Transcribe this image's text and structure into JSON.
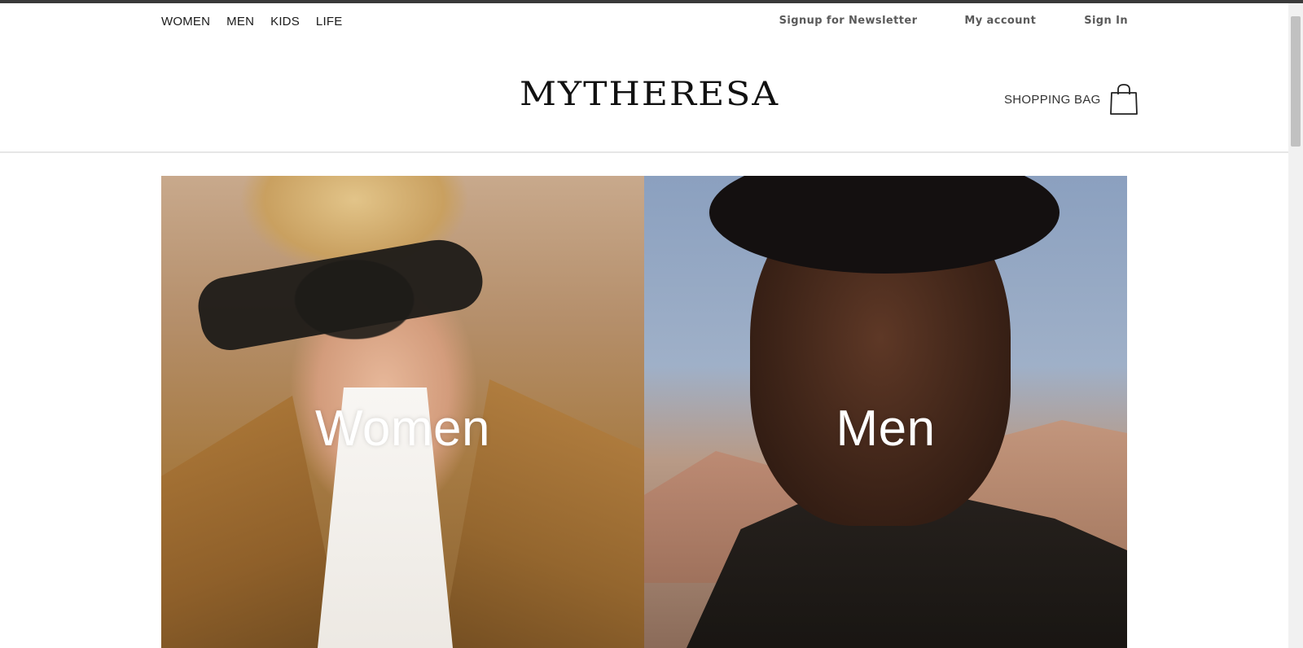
{
  "top_nav": {
    "departments": [
      "WOMEN",
      "MEN",
      "KIDS",
      "LIFE"
    ],
    "newsletter_label": "Signup for Newsletter",
    "account_label": "My account",
    "signin_label": "Sign In"
  },
  "header": {
    "logo_text": "MYTHERESA",
    "shopping_bag_label": "SHOPPING BAG",
    "shopping_bag_icon": "shopping-bag-icon"
  },
  "hero": {
    "panels": [
      {
        "label": "Women"
      },
      {
        "label": "Men"
      }
    ]
  },
  "colors": {
    "background": "#ffffff",
    "text": "#1a1a1a",
    "muted_text": "#5a5a5a",
    "divider": "#e6e6e6"
  }
}
